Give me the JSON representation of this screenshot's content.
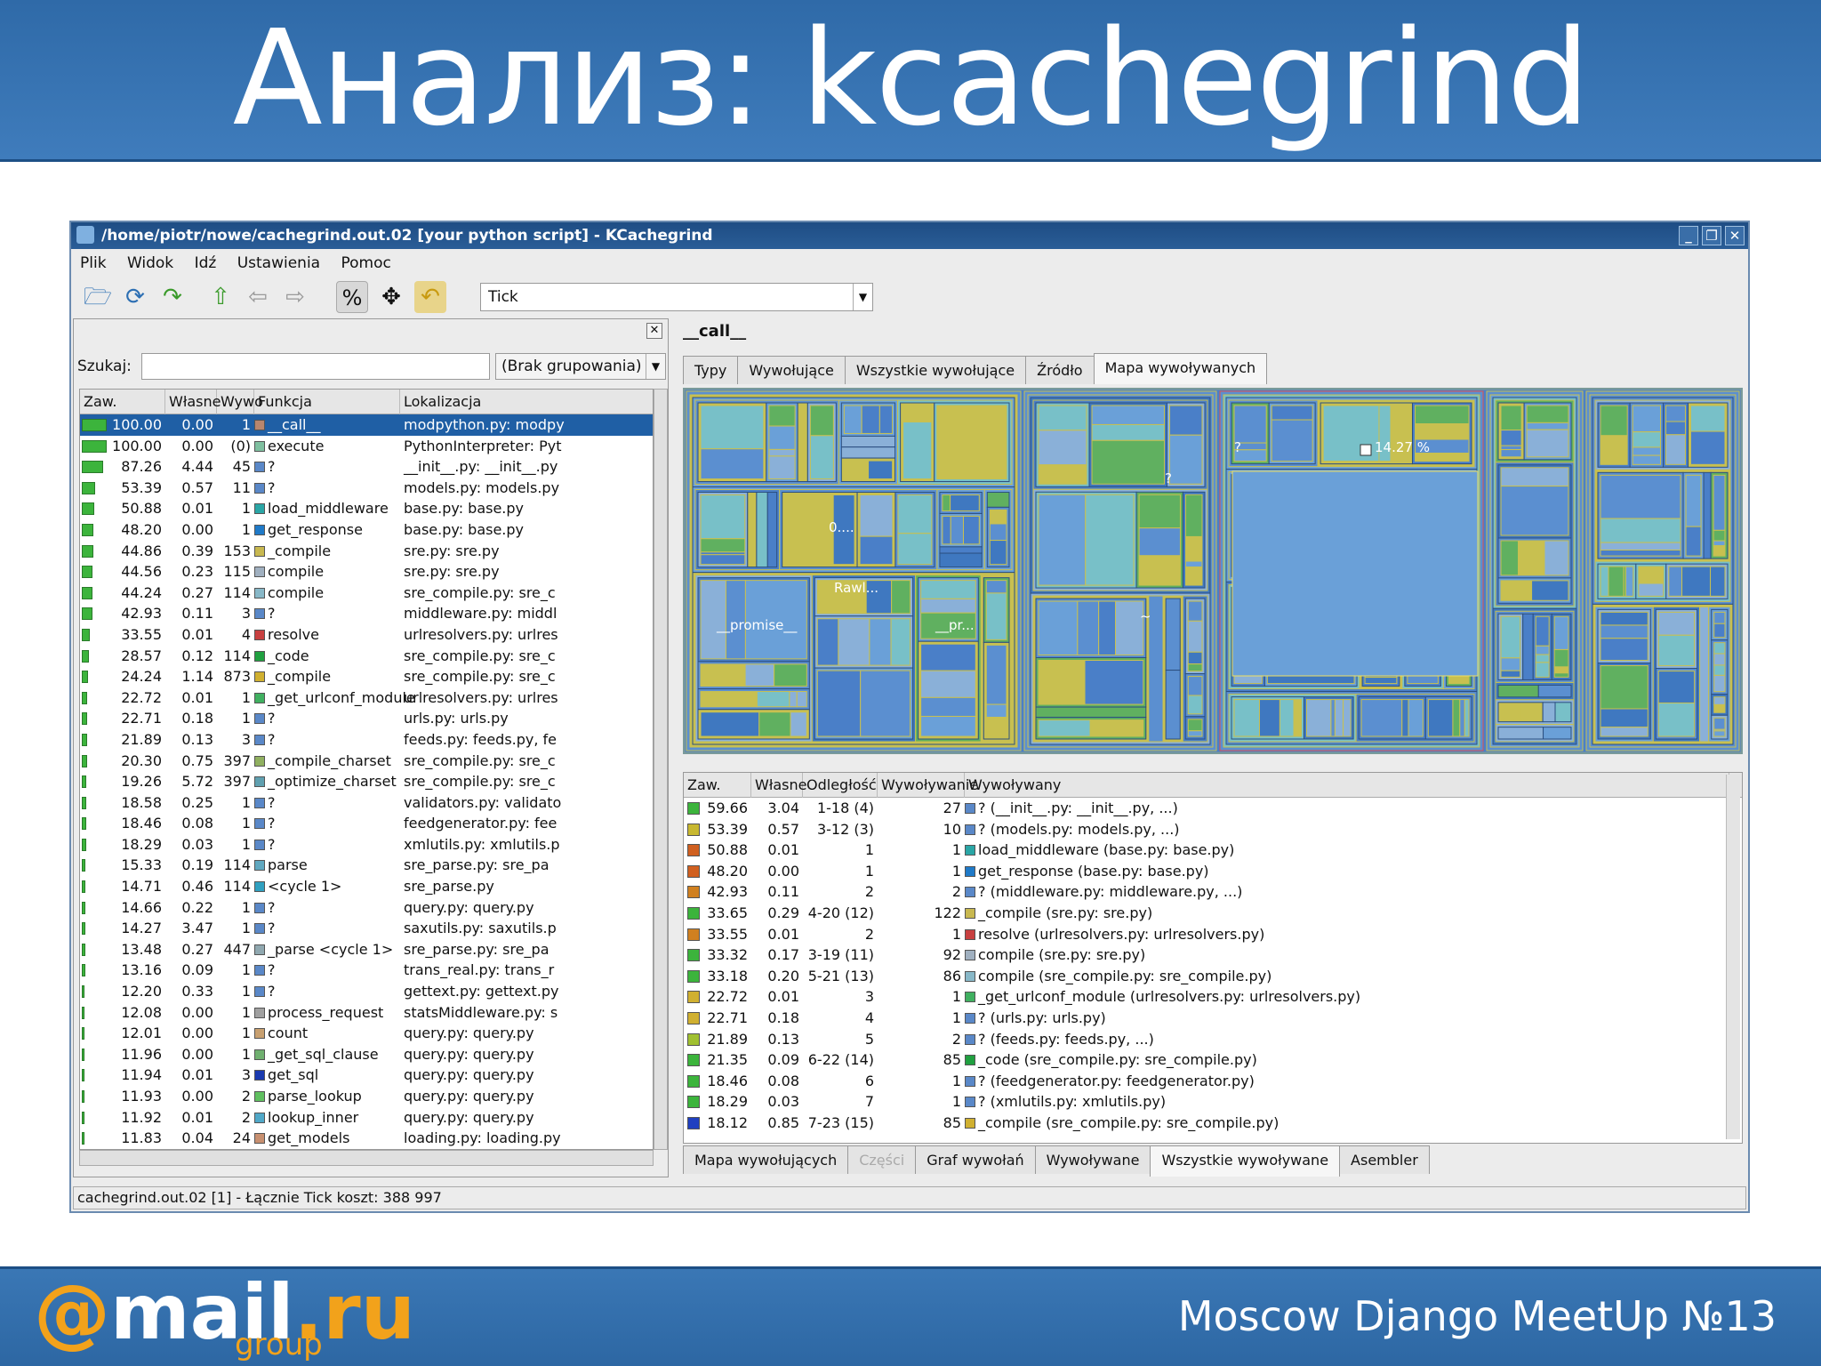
{
  "slide": {
    "title": "Анализ: kcachegrind",
    "footer_text": "Moscow Django MeetUp №13",
    "logo_at": "@",
    "logo_word": "mail",
    "logo_tld": ".ru",
    "logo_sub": "group"
  },
  "window": {
    "title": "/home/piotr/nowe/cachegrind.out.02 [your python script] - KCachegrind",
    "menu": [
      "Plik",
      "Widok",
      "Idź",
      "Ustawienia",
      "Pomoc"
    ],
    "event_type": "Tick",
    "status": "cachegrind.out.02 [1] - Łącznie Tick koszt:  388 997"
  },
  "left": {
    "search_label": "Szukaj:",
    "search_value": "",
    "grouping": "(Brak grupowania)",
    "columns": [
      "Zaw.",
      "Własne",
      "Wywo",
      "Funkcja",
      "Lokalizacja"
    ],
    "rows": [
      {
        "incl": "100.00",
        "self": "0.00",
        "calls": "1",
        "fn": "__call__",
        "loc": "modpython.py: modpy",
        "color": "#b8866e"
      },
      {
        "incl": "100.00",
        "self": "0.00",
        "calls": "(0)",
        "fn": "execute",
        "loc": "PythonInterpreter: Pyt",
        "color": "#7fc0a0"
      },
      {
        "incl": "87.26",
        "self": "4.44",
        "calls": "45",
        "fn": "?",
        "loc": "__init__.py: __init__.py",
        "color": "#5a88c8"
      },
      {
        "incl": "53.39",
        "self": "0.57",
        "calls": "11",
        "fn": "?",
        "loc": "models.py: models.py",
        "color": "#5a88c8"
      },
      {
        "incl": "50.88",
        "self": "0.01",
        "calls": "1",
        "fn": "load_middleware",
        "loc": "base.py: base.py",
        "color": "#2aa6a6"
      },
      {
        "incl": "48.20",
        "self": "0.00",
        "calls": "1",
        "fn": "get_response",
        "loc": "base.py: base.py",
        "color": "#1f7ac8"
      },
      {
        "incl": "44.86",
        "self": "0.39",
        "calls": "153",
        "fn": "_compile",
        "loc": "sre.py: sre.py",
        "color": "#c8b850"
      },
      {
        "incl": "44.56",
        "self": "0.23",
        "calls": "115",
        "fn": "compile",
        "loc": "sre.py: sre.py",
        "color": "#a0b0c0"
      },
      {
        "incl": "44.24",
        "self": "0.27",
        "calls": "114",
        "fn": "compile",
        "loc": "sre_compile.py: sre_c",
        "color": "#88b8c8"
      },
      {
        "incl": "42.93",
        "self": "0.11",
        "calls": "3",
        "fn": "?",
        "loc": "middleware.py: middl",
        "color": "#5a88c8"
      },
      {
        "incl": "33.55",
        "self": "0.01",
        "calls": "4",
        "fn": "resolve",
        "loc": "urlresolvers.py: urlres",
        "color": "#c84040"
      },
      {
        "incl": "28.57",
        "self": "0.12",
        "calls": "114",
        "fn": "_code",
        "loc": "sre_compile.py: sre_c",
        "color": "#20a040"
      },
      {
        "incl": "24.24",
        "self": "1.14",
        "calls": "873",
        "fn": "_compile",
        "loc": "sre_compile.py: sre_c",
        "color": "#d0b030"
      },
      {
        "incl": "22.72",
        "self": "0.01",
        "calls": "1",
        "fn": "_get_urlconf_module",
        "loc": "urlresolvers.py: urlres",
        "color": "#40b060"
      },
      {
        "incl": "22.71",
        "self": "0.18",
        "calls": "1",
        "fn": "?",
        "loc": "urls.py: urls.py",
        "color": "#5a88c8"
      },
      {
        "incl": "21.89",
        "self": "0.13",
        "calls": "3",
        "fn": "?",
        "loc": "feeds.py: feeds.py, fe",
        "color": "#5a88c8"
      },
      {
        "incl": "20.30",
        "self": "0.75",
        "calls": "397",
        "fn": "_compile_charset",
        "loc": "sre_compile.py: sre_c",
        "color": "#90b060"
      },
      {
        "incl": "19.26",
        "self": "5.72",
        "calls": "397",
        "fn": "_optimize_charset",
        "loc": "sre_compile.py: sre_c",
        "color": "#60a0b0"
      },
      {
        "incl": "18.58",
        "self": "0.25",
        "calls": "1",
        "fn": "?",
        "loc": "validators.py: validato",
        "color": "#5a88c8"
      },
      {
        "incl": "18.46",
        "self": "0.08",
        "calls": "1",
        "fn": "?",
        "loc": "feedgenerator.py: fee",
        "color": "#5a88c8"
      },
      {
        "incl": "18.29",
        "self": "0.03",
        "calls": "1",
        "fn": "?",
        "loc": "xmlutils.py: xmlutils.p",
        "color": "#5a88c8"
      },
      {
        "incl": "15.33",
        "self": "0.19",
        "calls": "114",
        "fn": "parse",
        "loc": "sre_parse.py: sre_pa",
        "color": "#60a8c0"
      },
      {
        "incl": "14.71",
        "self": "0.46",
        "calls": "114",
        "fn": "<cycle 1>",
        "loc": "sre_parse.py",
        "color": "#30a0c0"
      },
      {
        "incl": "14.66",
        "self": "0.22",
        "calls": "1",
        "fn": "?",
        "loc": "query.py: query.py",
        "color": "#5a88c8"
      },
      {
        "incl": "14.27",
        "self": "3.47",
        "calls": "1",
        "fn": "?",
        "loc": "saxutils.py: saxutils.p",
        "color": "#5a88c8"
      },
      {
        "incl": "13.48",
        "self": "0.27",
        "calls": "447",
        "fn": "_parse <cycle 1>",
        "loc": "sre_parse.py: sre_pa",
        "color": "#90a8b0"
      },
      {
        "incl": "13.16",
        "self": "0.09",
        "calls": "1",
        "fn": "?",
        "loc": "trans_real.py: trans_r",
        "color": "#5a88c8"
      },
      {
        "incl": "12.20",
        "self": "0.33",
        "calls": "1",
        "fn": "?",
        "loc": "gettext.py: gettext.py",
        "color": "#5a88c8"
      },
      {
        "incl": "12.08",
        "self": "0.00",
        "calls": "1",
        "fn": "process_request",
        "loc": "statsMiddleware.py: s",
        "color": "#a0a0a0"
      },
      {
        "incl": "12.01",
        "self": "0.00",
        "calls": "1",
        "fn": "count",
        "loc": "query.py: query.py",
        "color": "#c8a070"
      },
      {
        "incl": "11.96",
        "self": "0.00",
        "calls": "1",
        "fn": "_get_sql_clause",
        "loc": "query.py: query.py",
        "color": "#70b070"
      },
      {
        "incl": "11.94",
        "self": "0.01",
        "calls": "3",
        "fn": "get_sql",
        "loc": "query.py: query.py",
        "color": "#1a3ab0"
      },
      {
        "incl": "11.93",
        "self": "0.00",
        "calls": "2",
        "fn": "parse_lookup",
        "loc": "query.py: query.py",
        "color": "#60c060"
      },
      {
        "incl": "11.92",
        "self": "0.01",
        "calls": "2",
        "fn": "lookup_inner",
        "loc": "query.py: query.py",
        "color": "#50a8c8"
      },
      {
        "incl": "11.83",
        "self": "0.04",
        "calls": "24",
        "fn": "get_models",
        "loc": "loading.py: loading.py",
        "color": "#c89070"
      }
    ]
  },
  "right": {
    "function_name": "__call__",
    "top_tabs": [
      "Typy",
      "Wywołujące",
      "Wszystkie wywołujące",
      "Źródło",
      "Mapa wywoływanych"
    ],
    "treemap_labels": {
      "q1": "?",
      "pct": "14.27 %",
      "q2": "?",
      "o": "0....",
      "rawl": "Rawl...",
      "promise": "__promise__",
      "pr": "__pr...",
      "tilde": "~"
    },
    "callee_columns": [
      "Zaw.",
      "Własne",
      "Odległość",
      "Wywoływanie",
      "Wywoływany"
    ],
    "callees": [
      {
        "incl": "59.66",
        "self": "3.04",
        "dist": "1-18 (4)",
        "calls": "27",
        "name": "? (__init__.py: __init__.py, ...)",
        "color": "#5a88c8",
        "bar": "#3cb43c"
      },
      {
        "incl": "53.39",
        "self": "0.57",
        "dist": "3-12 (3)",
        "calls": "10",
        "name": "? (models.py: models.py, ...)",
        "color": "#5a88c8",
        "bar": "#c8b830"
      },
      {
        "incl": "50.88",
        "self": "0.01",
        "dist": "1",
        "calls": "1",
        "name": "load_middleware (base.py: base.py)",
        "color": "#2aa6a6",
        "bar": "#d06020"
      },
      {
        "incl": "48.20",
        "self": "0.00",
        "dist": "1",
        "calls": "1",
        "name": "get_response (base.py: base.py)",
        "color": "#1f7ac8",
        "bar": "#d06020"
      },
      {
        "incl": "42.93",
        "self": "0.11",
        "dist": "2",
        "calls": "2",
        "name": "? (middleware.py: middleware.py, ...)",
        "color": "#5a88c8",
        "bar": "#d08020"
      },
      {
        "incl": "33.65",
        "self": "0.29",
        "dist": "4-20 (12)",
        "calls": "122",
        "name": "_compile (sre.py: sre.py)",
        "color": "#c8b850",
        "bar": "#3cb43c"
      },
      {
        "incl": "33.55",
        "self": "0.01",
        "dist": "2",
        "calls": "1",
        "name": "resolve (urlresolvers.py: urlresolvers.py)",
        "color": "#c84040",
        "bar": "#d08020"
      },
      {
        "incl": "33.32",
        "self": "0.17",
        "dist": "3-19 (11)",
        "calls": "92",
        "name": "compile (sre.py: sre.py)",
        "color": "#a0b0c0",
        "bar": "#3cb43c"
      },
      {
        "incl": "33.18",
        "self": "0.20",
        "dist": "5-21 (13)",
        "calls": "86",
        "name": "compile (sre_compile.py: sre_compile.py)",
        "color": "#88b8c8",
        "bar": "#3cb43c"
      },
      {
        "incl": "22.72",
        "self": "0.01",
        "dist": "3",
        "calls": "1",
        "name": "_get_urlconf_module (urlresolvers.py: urlresolvers.py)",
        "color": "#40b060",
        "bar": "#d0b030"
      },
      {
        "incl": "22.71",
        "self": "0.18",
        "dist": "4",
        "calls": "1",
        "name": "? (urls.py: urls.py)",
        "color": "#5a88c8",
        "bar": "#d0b030"
      },
      {
        "incl": "21.89",
        "self": "0.13",
        "dist": "5",
        "calls": "2",
        "name": "? (feeds.py: feeds.py, ...)",
        "color": "#5a88c8",
        "bar": "#a0c030"
      },
      {
        "incl": "21.35",
        "self": "0.09",
        "dist": "6-22 (14)",
        "calls": "85",
        "name": "_code (sre_compile.py: sre_compile.py)",
        "color": "#20a040",
        "bar": "#3cb43c"
      },
      {
        "incl": "18.46",
        "self": "0.08",
        "dist": "6",
        "calls": "1",
        "name": "? (feedgenerator.py: feedgenerator.py)",
        "color": "#5a88c8",
        "bar": "#3cb43c"
      },
      {
        "incl": "18.29",
        "self": "0.03",
        "dist": "7",
        "calls": "1",
        "name": "? (xmlutils.py: xmlutils.py)",
        "color": "#5a88c8",
        "bar": "#3cb43c"
      },
      {
        "incl": "18.12",
        "self": "0.85",
        "dist": "7-23 (15)",
        "calls": "85",
        "name": "_compile (sre_compile.py: sre_compile.py)",
        "color": "#d0b030",
        "bar": "#2040c0"
      }
    ],
    "bottom_tabs": [
      "Mapa wywołujących",
      "Części",
      "Graf wywołań",
      "Wywoływane",
      "Wszystkie wywoływane",
      "Asembler"
    ]
  }
}
